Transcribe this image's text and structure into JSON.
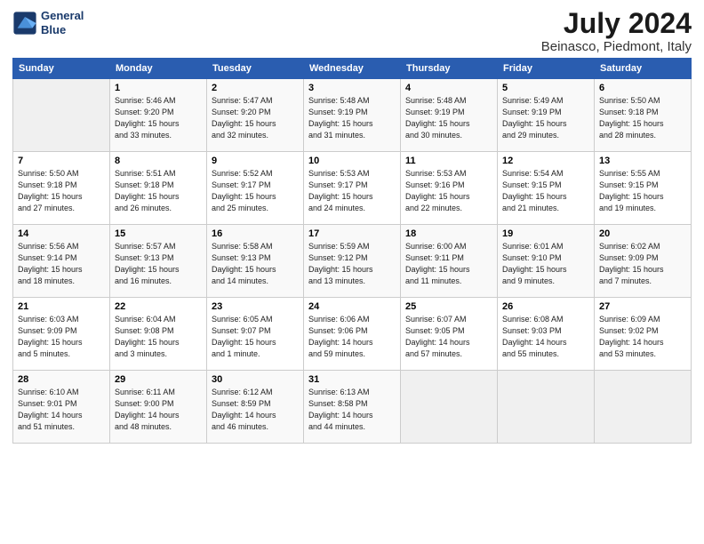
{
  "header": {
    "logo_line1": "General",
    "logo_line2": "Blue",
    "month_year": "July 2024",
    "location": "Beinasco, Piedmont, Italy"
  },
  "columns": [
    "Sunday",
    "Monday",
    "Tuesday",
    "Wednesday",
    "Thursday",
    "Friday",
    "Saturday"
  ],
  "weeks": [
    [
      {
        "day": "",
        "info": ""
      },
      {
        "day": "1",
        "info": "Sunrise: 5:46 AM\nSunset: 9:20 PM\nDaylight: 15 hours\nand 33 minutes."
      },
      {
        "day": "2",
        "info": "Sunrise: 5:47 AM\nSunset: 9:20 PM\nDaylight: 15 hours\nand 32 minutes."
      },
      {
        "day": "3",
        "info": "Sunrise: 5:48 AM\nSunset: 9:19 PM\nDaylight: 15 hours\nand 31 minutes."
      },
      {
        "day": "4",
        "info": "Sunrise: 5:48 AM\nSunset: 9:19 PM\nDaylight: 15 hours\nand 30 minutes."
      },
      {
        "day": "5",
        "info": "Sunrise: 5:49 AM\nSunset: 9:19 PM\nDaylight: 15 hours\nand 29 minutes."
      },
      {
        "day": "6",
        "info": "Sunrise: 5:50 AM\nSunset: 9:18 PM\nDaylight: 15 hours\nand 28 minutes."
      }
    ],
    [
      {
        "day": "7",
        "info": "Sunrise: 5:50 AM\nSunset: 9:18 PM\nDaylight: 15 hours\nand 27 minutes."
      },
      {
        "day": "8",
        "info": "Sunrise: 5:51 AM\nSunset: 9:18 PM\nDaylight: 15 hours\nand 26 minutes."
      },
      {
        "day": "9",
        "info": "Sunrise: 5:52 AM\nSunset: 9:17 PM\nDaylight: 15 hours\nand 25 minutes."
      },
      {
        "day": "10",
        "info": "Sunrise: 5:53 AM\nSunset: 9:17 PM\nDaylight: 15 hours\nand 24 minutes."
      },
      {
        "day": "11",
        "info": "Sunrise: 5:53 AM\nSunset: 9:16 PM\nDaylight: 15 hours\nand 22 minutes."
      },
      {
        "day": "12",
        "info": "Sunrise: 5:54 AM\nSunset: 9:15 PM\nDaylight: 15 hours\nand 21 minutes."
      },
      {
        "day": "13",
        "info": "Sunrise: 5:55 AM\nSunset: 9:15 PM\nDaylight: 15 hours\nand 19 minutes."
      }
    ],
    [
      {
        "day": "14",
        "info": "Sunrise: 5:56 AM\nSunset: 9:14 PM\nDaylight: 15 hours\nand 18 minutes."
      },
      {
        "day": "15",
        "info": "Sunrise: 5:57 AM\nSunset: 9:13 PM\nDaylight: 15 hours\nand 16 minutes."
      },
      {
        "day": "16",
        "info": "Sunrise: 5:58 AM\nSunset: 9:13 PM\nDaylight: 15 hours\nand 14 minutes."
      },
      {
        "day": "17",
        "info": "Sunrise: 5:59 AM\nSunset: 9:12 PM\nDaylight: 15 hours\nand 13 minutes."
      },
      {
        "day": "18",
        "info": "Sunrise: 6:00 AM\nSunset: 9:11 PM\nDaylight: 15 hours\nand 11 minutes."
      },
      {
        "day": "19",
        "info": "Sunrise: 6:01 AM\nSunset: 9:10 PM\nDaylight: 15 hours\nand 9 minutes."
      },
      {
        "day": "20",
        "info": "Sunrise: 6:02 AM\nSunset: 9:09 PM\nDaylight: 15 hours\nand 7 minutes."
      }
    ],
    [
      {
        "day": "21",
        "info": "Sunrise: 6:03 AM\nSunset: 9:09 PM\nDaylight: 15 hours\nand 5 minutes."
      },
      {
        "day": "22",
        "info": "Sunrise: 6:04 AM\nSunset: 9:08 PM\nDaylight: 15 hours\nand 3 minutes."
      },
      {
        "day": "23",
        "info": "Sunrise: 6:05 AM\nSunset: 9:07 PM\nDaylight: 15 hours\nand 1 minute."
      },
      {
        "day": "24",
        "info": "Sunrise: 6:06 AM\nSunset: 9:06 PM\nDaylight: 14 hours\nand 59 minutes."
      },
      {
        "day": "25",
        "info": "Sunrise: 6:07 AM\nSunset: 9:05 PM\nDaylight: 14 hours\nand 57 minutes."
      },
      {
        "day": "26",
        "info": "Sunrise: 6:08 AM\nSunset: 9:03 PM\nDaylight: 14 hours\nand 55 minutes."
      },
      {
        "day": "27",
        "info": "Sunrise: 6:09 AM\nSunset: 9:02 PM\nDaylight: 14 hours\nand 53 minutes."
      }
    ],
    [
      {
        "day": "28",
        "info": "Sunrise: 6:10 AM\nSunset: 9:01 PM\nDaylight: 14 hours\nand 51 minutes."
      },
      {
        "day": "29",
        "info": "Sunrise: 6:11 AM\nSunset: 9:00 PM\nDaylight: 14 hours\nand 48 minutes."
      },
      {
        "day": "30",
        "info": "Sunrise: 6:12 AM\nSunset: 8:59 PM\nDaylight: 14 hours\nand 46 minutes."
      },
      {
        "day": "31",
        "info": "Sunrise: 6:13 AM\nSunset: 8:58 PM\nDaylight: 14 hours\nand 44 minutes."
      },
      {
        "day": "",
        "info": ""
      },
      {
        "day": "",
        "info": ""
      },
      {
        "day": "",
        "info": ""
      }
    ]
  ]
}
